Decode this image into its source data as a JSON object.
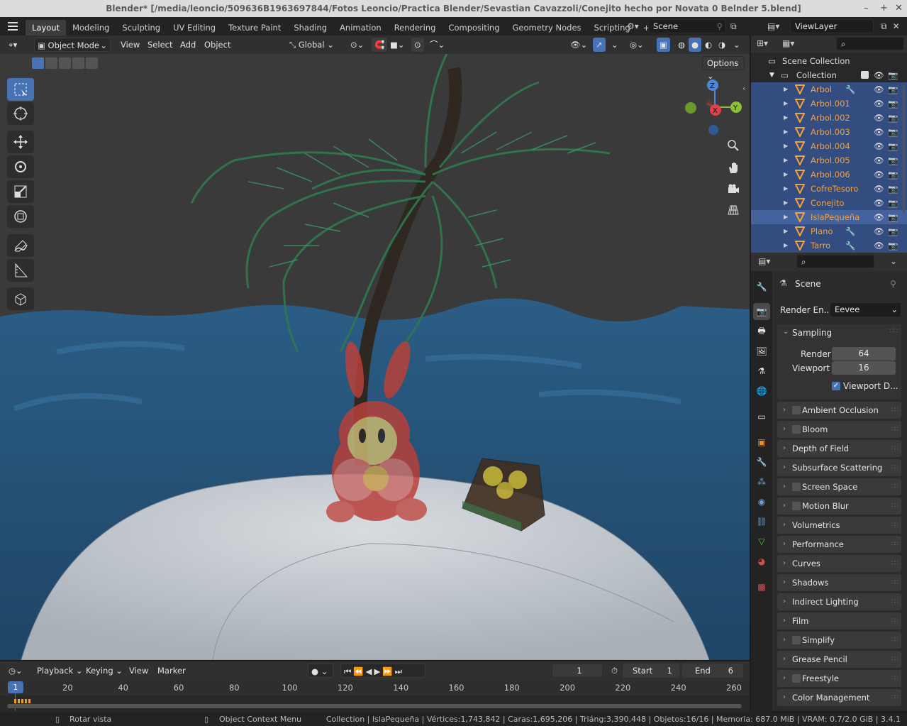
{
  "window": {
    "title": "Blender* [/media/leoncio/509636B1963697844/Fotos Leoncio/Practica Blender/Sevastian Cavazzoli/Conejito hecho por Novata 0 Belnder 5.blend]",
    "min": "–",
    "max": "+",
    "close": "✕"
  },
  "workspaces": [
    "Layout",
    "Modeling",
    "Sculpting",
    "UV Editing",
    "Texture Paint",
    "Shading",
    "Animation",
    "Rendering",
    "Compositing",
    "Geometry Nodes",
    "Scripting",
    "+"
  ],
  "scene": {
    "name": "Scene",
    "view_layer": "ViewLayer"
  },
  "viewport_header": {
    "mode": "Object Mode",
    "menus": [
      "View",
      "Select",
      "Add",
      "Object"
    ],
    "transform_orientation": "Global",
    "options": "Options"
  },
  "outliner": {
    "root": "Scene Collection",
    "collection": "Collection",
    "items": [
      {
        "name": "Arbol",
        "modifier": true
      },
      {
        "name": "Arbol.001",
        "modifier": false
      },
      {
        "name": "Arbol.002",
        "modifier": false
      },
      {
        "name": "Arbol.003",
        "modifier": false
      },
      {
        "name": "Arbol.004",
        "modifier": false
      },
      {
        "name": "Arbol.005",
        "modifier": false
      },
      {
        "name": "Arbol.006",
        "modifier": false
      },
      {
        "name": "CofreTesoro",
        "modifier": false
      },
      {
        "name": "Conejito",
        "modifier": false
      },
      {
        "name": "IslaPequeña",
        "modifier": false
      },
      {
        "name": "Plano",
        "modifier": true
      },
      {
        "name": "Tarro",
        "modifier": true
      }
    ]
  },
  "properties": {
    "context": "Scene",
    "render_engine_label": "Render En...",
    "render_engine": "Eevee",
    "sampling": {
      "title": "Sampling",
      "render_label": "Render",
      "render": "64",
      "viewport_label": "Viewport",
      "viewport": "16",
      "denoise_label": "Viewport D..."
    },
    "panels": [
      {
        "label": "Ambient Occlusion",
        "checkbox": true
      },
      {
        "label": "Bloom",
        "checkbox": true
      },
      {
        "label": "Depth of Field",
        "checkbox": false
      },
      {
        "label": "Subsurface Scattering",
        "checkbox": false
      },
      {
        "label": "Screen Space Reflections",
        "checkbox": true
      },
      {
        "label": "Motion Blur",
        "checkbox": true
      },
      {
        "label": "Volumetrics",
        "checkbox": false
      },
      {
        "label": "Performance",
        "checkbox": false
      },
      {
        "label": "Curves",
        "checkbox": false
      },
      {
        "label": "Shadows",
        "checkbox": false
      },
      {
        "label": "Indirect Lighting",
        "checkbox": false
      },
      {
        "label": "Film",
        "checkbox": false
      },
      {
        "label": "Simplify",
        "checkbox": true
      },
      {
        "label": "Grease Pencil",
        "checkbox": false
      },
      {
        "label": "Freestyle",
        "checkbox": true
      },
      {
        "label": "Color Management",
        "checkbox": false
      }
    ]
  },
  "timeline": {
    "menus": [
      "Playback",
      "Keying",
      "View",
      "Marker"
    ],
    "current_frame": "1",
    "start_label": "Start",
    "start": "1",
    "end_label": "End",
    "end": "6",
    "ticks": [
      "20",
      "40",
      "60",
      "80",
      "100",
      "120",
      "140",
      "160",
      "180",
      "200",
      "220",
      "240",
      "260"
    ],
    "playhead": "1"
  },
  "statusbar": {
    "left_hint": "Rotar vista",
    "mid_hint": "Object Context Menu",
    "stats": "Collection | IslaPequeña | Vértices:1,743,842 | Caras:1,695,206 | Triáng:3,390,448 | Objetos:16/16 | Memoria: 687.0 MiB | VRAM: 0.7/2.0 GiB | 3.4.1"
  },
  "gizmo": {
    "x": "X",
    "y": "Y",
    "z": "Z"
  },
  "colors": {
    "accent": "#4772b3",
    "selected_row": "#334d80",
    "object_name": "#f5a03c",
    "viewport_bg": "#3c3c3c",
    "water": "#2a5678",
    "island": "#c7ccd1"
  }
}
